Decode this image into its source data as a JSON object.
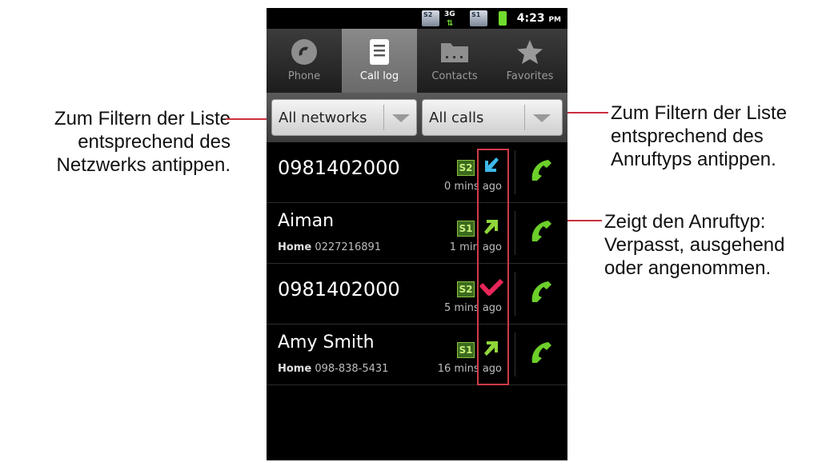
{
  "annotations": {
    "left": [
      "Zum Filtern der Liste",
      "entsprechend des",
      "Netzwerks antippen."
    ],
    "right1": [
      "Zum Filtern der Liste",
      "entsprechend des",
      "Anruftyps antippen."
    ],
    "right2": [
      "Zeigt den Anruftyp:",
      "Verpasst, ausgehend",
      "oder angenommen."
    ]
  },
  "statusbar": {
    "sim_labels": [
      "S2",
      "3G",
      "S1"
    ],
    "time": "4:23",
    "ampm": "PM"
  },
  "tabs": [
    {
      "label": "Phone",
      "icon": "phone-icon",
      "active": false
    },
    {
      "label": "Call log",
      "icon": "call-log-icon",
      "active": true
    },
    {
      "label": "Contacts",
      "icon": "contacts-icon",
      "active": false
    },
    {
      "label": "Favorites",
      "icon": "star-icon",
      "active": false
    }
  ],
  "filters": {
    "network": "All networks",
    "calls": "All calls"
  },
  "calls": [
    {
      "name": "0981402000",
      "sub_label": "",
      "sub_number": "",
      "sim": "S2",
      "type": "incoming",
      "time": "0 mins ago"
    },
    {
      "name": "Aiman",
      "sub_label": "Home",
      "sub_number": "0227216891",
      "sim": "S1",
      "type": "outgoing",
      "time": "1 min ago"
    },
    {
      "name": "0981402000",
      "sub_label": "",
      "sub_number": "",
      "sim": "S2",
      "type": "missed",
      "time": "5 mins ago"
    },
    {
      "name": "Amy Smith",
      "sub_label": "Home",
      "sub_number": "098-838-5431",
      "sim": "S1",
      "type": "outgoing",
      "time": "16 mins ago"
    }
  ],
  "colors": {
    "incoming": "#3fb8e8",
    "outgoing": "#8fd63a",
    "missed": "#e8265a",
    "call_button": "#6ccf2a",
    "annotation_line": "#c9303f"
  }
}
